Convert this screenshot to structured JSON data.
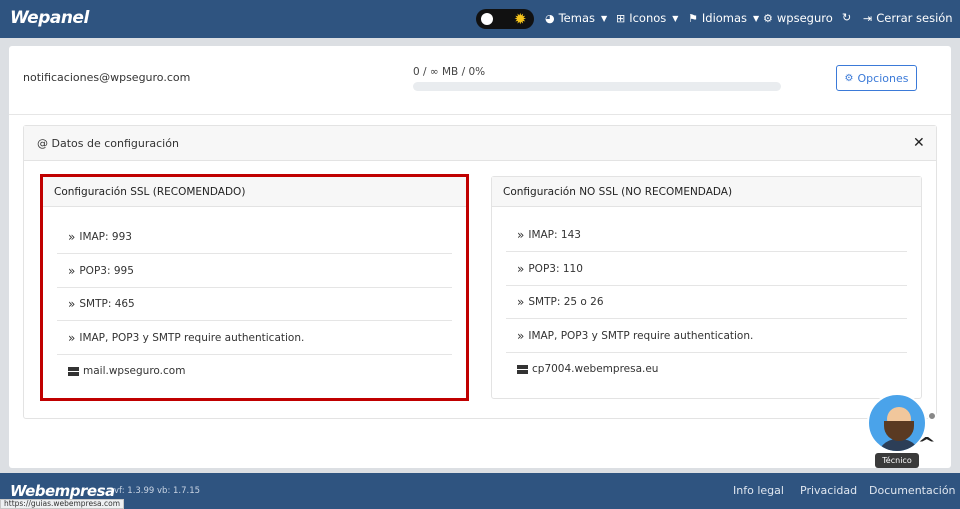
{
  "header": {
    "logo": "Wepanel",
    "nav": [
      {
        "icon": "palette-icon",
        "label": "Temas",
        "caret": true
      },
      {
        "icon": "sitemap-icon",
        "label": "Iconos",
        "caret": true
      },
      {
        "icon": "flag-icon",
        "label": "Idiomas",
        "caret": true
      },
      {
        "icon": "user-gear-icon",
        "label": "wpseguro",
        "caret": false
      },
      {
        "icon": "refresh-icon",
        "label": "",
        "caret": false
      },
      {
        "icon": "logout-icon",
        "label": "Cerrar sesión",
        "caret": false
      }
    ]
  },
  "account": {
    "email": "notificaciones@wpseguro.com",
    "quota": "0 / ∞ MB / 0%",
    "quota_percent": 0,
    "options_label": "Opciones"
  },
  "config": {
    "title": "Datos de configuración",
    "ssl": {
      "title": "Configuración SSL (RECOMENDADO)",
      "rows": [
        "IMAP: 993",
        "POP3: 995",
        "SMTP: 465",
        "IMAP, POP3 y SMTP require authentication."
      ],
      "server": "mail.wpseguro.com"
    },
    "nossl": {
      "title": "Configuración NO SSL (NO RECOMENDADA)",
      "rows": [
        "IMAP: 143",
        "POP3: 110",
        "SMTP: 25 o 26",
        "IMAP, POP3 y SMTP require authentication."
      ],
      "server": "cp7004.webempresa.eu"
    }
  },
  "support": {
    "badge": "Técnico"
  },
  "footer": {
    "logo": "Webempresa",
    "version": "vf: 1.3.99 vb: 1.7.15",
    "links": [
      "Info legal",
      "Privacidad",
      "Documentación"
    ]
  },
  "status_bar": {
    "url": "https://guias.webempresa.com"
  },
  "colors": {
    "header_bg": "#2f5480",
    "highlight_border": "#c00000",
    "primary": "#3b7ad8"
  }
}
